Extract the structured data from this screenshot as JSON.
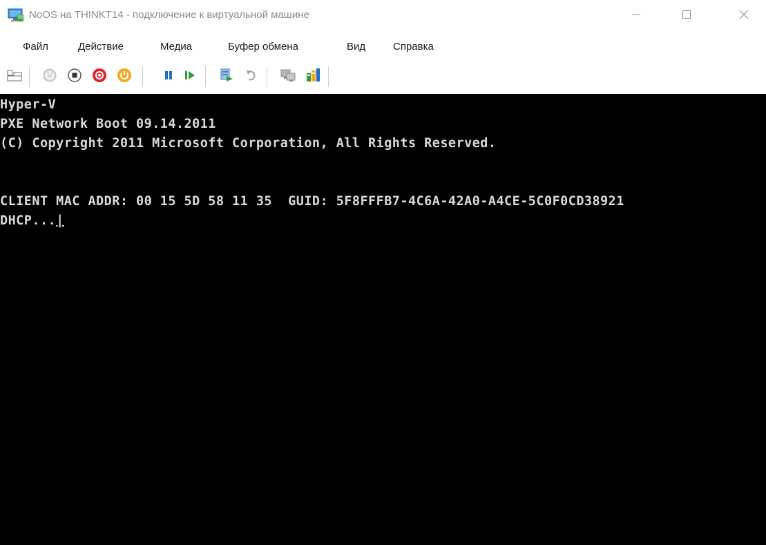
{
  "window": {
    "title": "NoOS на THINKT14 - подключение к виртуальной машине",
    "minimize_icon": "minimize-icon",
    "maximize_icon": "maximize-icon",
    "close_icon": "close-icon"
  },
  "menu": {
    "items": [
      {
        "label": "Файл"
      },
      {
        "label": "Действие"
      },
      {
        "label": "Медиа"
      },
      {
        "label": "Буфер обмена"
      },
      {
        "label": "Вид"
      },
      {
        "label": "Справка"
      }
    ]
  },
  "toolbar": {
    "buttons": [
      {
        "icon": "ctrl-alt-del-icon"
      },
      {
        "icon": "start-icon"
      },
      {
        "icon": "turn-off-icon"
      },
      {
        "icon": "shutdown-icon"
      },
      {
        "icon": "power-icon"
      },
      {
        "icon": "pause-icon"
      },
      {
        "icon": "resume-icon"
      },
      {
        "icon": "checkpoint-icon"
      },
      {
        "icon": "revert-icon"
      },
      {
        "icon": "enhanced-session-icon"
      },
      {
        "icon": "share-icon"
      }
    ],
    "colors": {
      "red": "#d7262e",
      "orange": "#f5a623",
      "blue": "#1e6fbf",
      "green": "#2f9e3a",
      "gray": "#9c9c9c"
    }
  },
  "console": {
    "lines": [
      "Hyper-V",
      "PXE Network Boot 09.14.2011",
      "(C) Copyright 2011 Microsoft Corporation, All Rights Reserved.",
      "",
      "",
      "CLIENT MAC ADDR: 00 15 5D 58 11 35  GUID: 5F8FFFB7-4C6A-42A0-A4CE-5C0F0CD38921",
      "DHCP..."
    ],
    "cursor_char": "|"
  }
}
